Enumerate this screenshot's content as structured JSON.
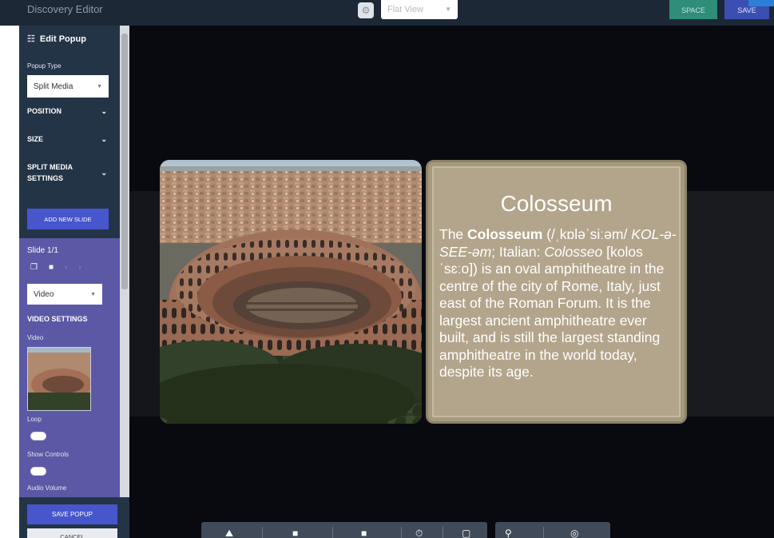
{
  "header": {
    "app_title": "Discovery Editor",
    "view_mode": "Flat View",
    "space_label": "SPACE",
    "save_label": "SAVE"
  },
  "sidebar": {
    "title": "Edit Popup",
    "popup_type_label": "Popup Type",
    "popup_type_value": "Split Media",
    "sections": {
      "position": "POSITION",
      "size": "SIZE",
      "split_media_line1": "SPLIT MEDIA",
      "split_media_line2": "SETTINGS"
    },
    "add_slide_label": "ADD NEW SLIDE",
    "slide": {
      "counter": "Slide 1/1",
      "media_type": "Video",
      "video_settings_heading": "VIDEO SETTINGS",
      "video_label": "Video",
      "loop_label": "Loop",
      "show_controls_label": "Show Controls",
      "audio_volume_label": "Audio Volume"
    },
    "save_popup_label": "SAVE POPUP",
    "cancel_label": "CANCEL"
  },
  "popup": {
    "title": "Colosseum",
    "body": {
      "t1": "The ",
      "name": "Colosseum",
      "t2": " (/ˌkɒləˈsiːəm/ ",
      "pron": "KOL-ə-SEE-əm",
      "t3": "; Italian: ",
      "italian": "Colosseo",
      "t4": " [kolosˈsɛːo]) is an oval amphitheatre in the centre of the city of Rome, Italy, just east of the Roman Forum. It is the largest ancient amphitheatre ever built, and is still the largest standing amphitheatre in the world today, despite its age."
    }
  },
  "colors": {
    "sidebar_bg": "#243447",
    "slide_panel_bg": "#5b59a6",
    "primary_button": "#4756cc",
    "space_button": "#2e8e78",
    "card_bg": "#b3a58b"
  },
  "icons": {
    "sidebar_title": "sliders-icon",
    "slide_tools": [
      "copy-icon",
      "trash-icon",
      "chevron-left-icon",
      "chevron-right-icon"
    ],
    "toolbar": [
      "mountain-image-icon",
      "square-media-icon",
      "square-text-icon",
      "timer-icon",
      "frame-icon",
      "hotspot-pin-icon",
      "target-add-icon"
    ]
  }
}
